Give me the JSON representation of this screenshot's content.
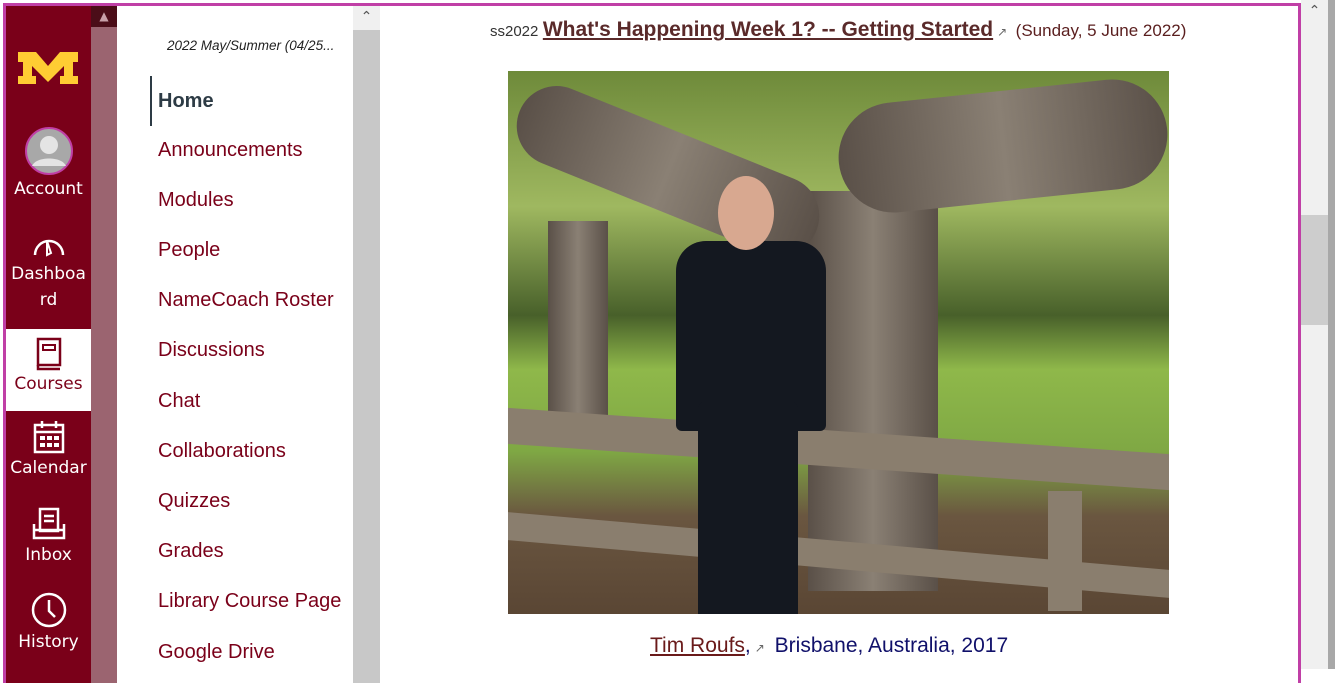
{
  "global_nav": {
    "items": [
      {
        "label": "Account",
        "icon": "avatar-icon"
      },
      {
        "label": "Dashboard",
        "icon": "dashboard-icon"
      },
      {
        "label": "Courses",
        "icon": "courses-icon",
        "active": true
      },
      {
        "label": "Calendar",
        "icon": "calendar-icon"
      },
      {
        "label": "Inbox",
        "icon": "inbox-icon"
      },
      {
        "label": "History",
        "icon": "clock-icon"
      }
    ],
    "logo": "M",
    "color": "#7a0019",
    "logo_color": "#ffcc33"
  },
  "course_nav": {
    "term": "2022 May/Summer (04/25...",
    "items": [
      "Home",
      "Announcements",
      "Modules",
      "People",
      "NameCoach Roster",
      "Discussions",
      "Chat",
      "Collaborations",
      "Quizzes",
      "Grades",
      "Library Course Page",
      "Google Drive"
    ],
    "active": "Home"
  },
  "content": {
    "tag": "ss2022",
    "title": "What's Happening Week 1? -- Getting Started",
    "date": "(Sunday, 5 June 2022)",
    "caption_link": "Tim Roufs",
    "caption_sep": ",",
    "caption_text": "Brisbane, Australia, 2017"
  }
}
